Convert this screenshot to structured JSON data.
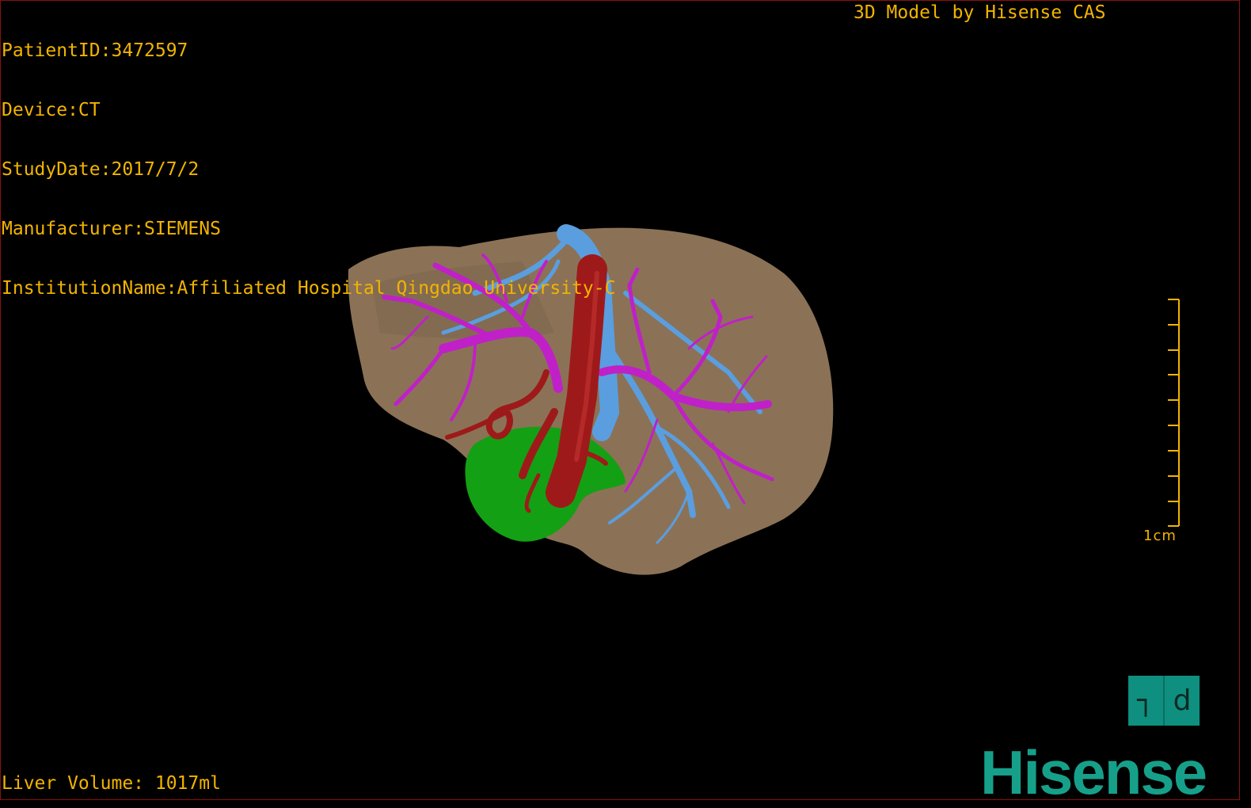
{
  "overlay": {
    "patient_id": "PatientID:3472597",
    "device": "Device:CT",
    "study_date": "StudyDate:2017/7/2",
    "manufacturer": "Manufacturer:SIEMENS",
    "institution": "InstitutionName:Affiliated Hospital Qingdao University-C",
    "model_credit": "3D Model by Hisense CAS",
    "liver_volume": "Liver Volume: 1017ml"
  },
  "scale_bar": {
    "label": "1cm"
  },
  "orientation": {
    "left": "┐",
    "right": "d"
  },
  "brand": {
    "logo": "Hisense"
  },
  "colors": {
    "text": "#f2b400",
    "liver": "#8b7256",
    "portal_vein": "#c020c8",
    "hepatic_vein": "#5a9ee0",
    "artery": "#9e1a1a",
    "gallbladder": "#14a014",
    "brand": "#16a08a"
  }
}
